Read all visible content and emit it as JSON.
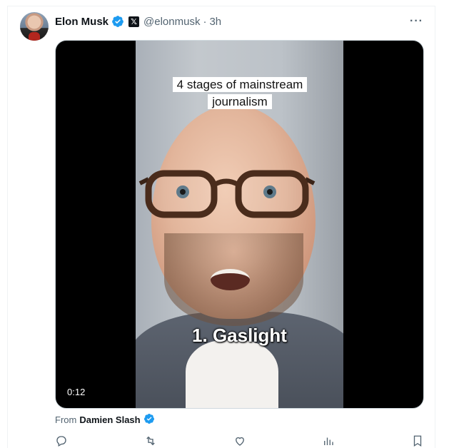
{
  "tweet": {
    "author_name": "Elon Musk",
    "handle": "@elonmusk",
    "separator": "·",
    "time": "3h",
    "more_label": "···"
  },
  "media": {
    "caption_top": "4 stages of mainstream journalism",
    "caption_bottom": "1. Gaslight",
    "duration": "0:12"
  },
  "attribution": {
    "prefix": "From",
    "source_name": "Damien Slash"
  },
  "colors": {
    "verified": "#1d9bf0",
    "text_primary": "#0f1419",
    "text_secondary": "#536471",
    "border": "#cfd9de"
  }
}
